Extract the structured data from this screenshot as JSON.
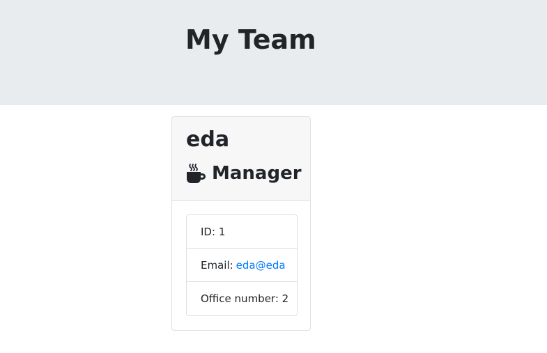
{
  "header": {
    "title": "My Team"
  },
  "employees": [
    {
      "name": "eda",
      "role": "Manager",
      "role_icon": "coffee-mug-icon",
      "details": {
        "id_label": "ID:",
        "id_value": "1",
        "email_label": "Email:",
        "email_value": "eda@eda",
        "office_label": "Office number:",
        "office_value": "2"
      }
    }
  ],
  "colors": {
    "jumbotron_bg": "#e9ecef",
    "card_header_bg": "#f7f7f7",
    "link": "#007bff",
    "text": "#212529"
  }
}
